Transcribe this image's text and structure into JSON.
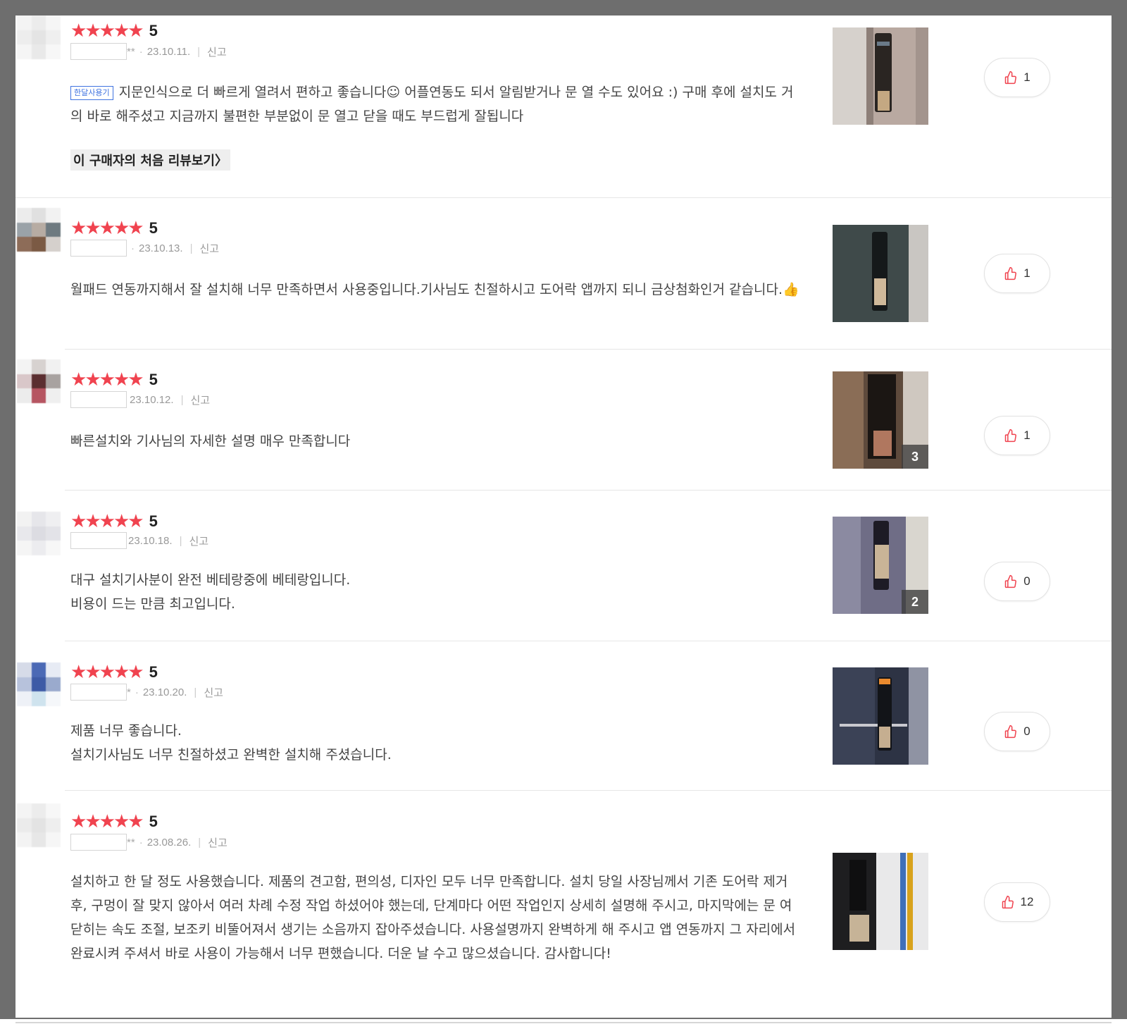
{
  "reviews": [
    {
      "score": "5",
      "masked_suffix": "**",
      "date": "23.10.11.",
      "report_label": "신고",
      "tag": "한달사용기",
      "text": "지문인식으로 더 빠르게 열려서 편하고 좋습니다☺ 어플연동도 되서 알림받거나 문 열 수도 있어요 :) 구매 후에 설치도 거의 바로 해주셨고 지금까지 불편한 부분없이 문 열고 닫을 때도 부드럽게 잘됩니다",
      "first_review_link": "이 구매자의 처음 리뷰보기〉",
      "likes": "1",
      "photo_count": ""
    },
    {
      "score": "5",
      "masked_suffix": "",
      "date": "23.10.13.",
      "report_label": "신고",
      "text": "월패드 연동까지해서 잘 설치해 너무 만족하면서 사용중입니다.기사님도 친절하시고 도어락 앱까지 되니 금상첨화인거 같습니다.👍",
      "likes": "1",
      "photo_count": ""
    },
    {
      "score": "5",
      "masked_suffix": "",
      "date": "23.10.12.",
      "report_label": "신고",
      "text": "빠른설치와 기사님의 자세한 설명 매우 만족합니다",
      "likes": "1",
      "photo_count": "3"
    },
    {
      "score": "5",
      "masked_suffix": "",
      "date": "23.10.18.",
      "report_label": "신고",
      "text_line1": "대구 설치기사분이 완전 베테랑중에 베테랑입니다.",
      "text_line2": "비용이 드는 만큼 최고입니다.",
      "likes": "0",
      "photo_count": "2"
    },
    {
      "score": "5",
      "masked_suffix": "*",
      "date": "23.10.20.",
      "report_label": "신고",
      "text_line1": "제품 너무 좋습니다.",
      "text_line2": "설치기사님도 너무 친절하셨고 완벽한 설치해 주셨습니다.",
      "likes": "0",
      "photo_count": ""
    },
    {
      "score": "5",
      "masked_suffix": "**",
      "date": "23.08.26.",
      "report_label": "신고",
      "text": "설치하고 한 달 정도 사용했습니다. 제품의 견고함, 편의성, 디자인 모두 너무 만족합니다. 설치 당일 사장님께서 기존 도어락 제거 후, 구멍이 잘 맞지 않아서 여러 차례 수정 작업 하셨어야 했는데, 단계마다 어떤 작업인지 상세히 설명해 주시고, 마지막에는 문 여닫히는 속도 조절, 보조키 비뚤어져서 생기는 소음까지 잡아주셨습니다. 사용설명까지 완벽하게 해 주시고 앱 연동까지 그 자리에서 완료시켜 주셔서 바로 사용이 가능해서 너무 편했습니다. 더운 날 수고 많으셨습니다. 감사합니다!",
      "likes": "12",
      "photo_count": ""
    }
  ],
  "colors": {
    "star": "#f0434f",
    "tag_blue": "#3f73e0",
    "frame": "#6e6e6e"
  },
  "icons": {
    "star": "star-icon",
    "like": "thumbs-up-icon"
  }
}
